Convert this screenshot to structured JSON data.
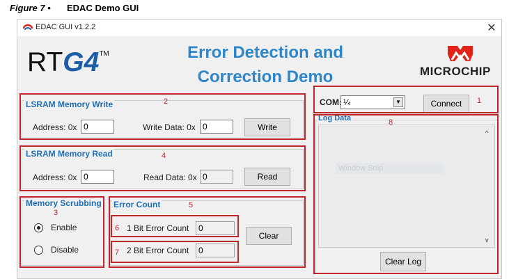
{
  "caption": {
    "figure": "Figure 7 •",
    "title": "EDAC Demo GUI"
  },
  "window": {
    "title": "EDAC GUI v1.2.2",
    "close_glyph": "✕"
  },
  "header": {
    "rtg4_prefix": "RT",
    "rtg4_suffix": "G4",
    "rtg4_tm": "TM",
    "title_line1": "Error Detection and",
    "title_line2": "Correction Demo",
    "microchip_text": "MICROCHIP"
  },
  "lsram_write": {
    "title": "LSRAM Memory Write",
    "address_label": "Address: 0x",
    "address_value": "0",
    "data_label": "Write Data: 0x",
    "data_value": "0",
    "button": "Write"
  },
  "lsram_read": {
    "title": "LSRAM Memory Read",
    "address_label": "Address: 0x",
    "address_value": "0",
    "data_label": "Read Data: 0x",
    "data_value": "0",
    "button": "Read"
  },
  "scrubbing": {
    "title": "Memory Scrubbing",
    "enable_label": "Enable",
    "disable_label": "Disable",
    "selected": "Enable"
  },
  "error_count": {
    "title": "Error Count",
    "one_bit_label": "1 Bit Error Count",
    "one_bit_value": "0",
    "two_bit_label": "2 Bit Error Count",
    "two_bit_value": "0",
    "button": "Clear"
  },
  "com": {
    "label": "COM:",
    "value": "¼",
    "button": "Connect"
  },
  "log": {
    "title": "Log Data",
    "snip_text": "Window Snip",
    "button": "Clear Log"
  },
  "annotations": [
    "1",
    "2",
    "3",
    "4",
    "5",
    "6",
    "7",
    "8"
  ],
  "colors": {
    "accent": "#1f6fb5",
    "title_blue": "#2e86c9",
    "annotation_red": "#c0272d",
    "logo_red": "#e2231a"
  },
  "icons": {
    "app": "edac-app-icon",
    "close": "close-icon",
    "dropdown": "dropdown-arrow-icon",
    "scroll_up": "scroll-up-icon",
    "scroll_down": "scroll-down-icon"
  }
}
